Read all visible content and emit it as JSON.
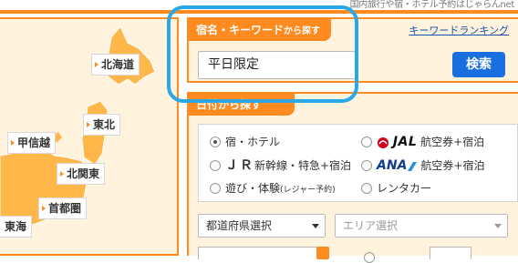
{
  "header": {
    "tagline": "国内旅行や宿・ホテル予約はじゃらんnet"
  },
  "map": {
    "regions": [
      {
        "id": "hokkaido",
        "label": "北海道"
      },
      {
        "id": "tohoku",
        "label": "東北"
      },
      {
        "id": "koshinetsu",
        "label": "甲信越"
      },
      {
        "id": "kitakanto",
        "label": "北関東"
      },
      {
        "id": "shutoken",
        "label": "首都圏"
      },
      {
        "id": "tokai",
        "label": "東海"
      }
    ],
    "colors": {
      "land": "#ffb74a",
      "background": "#fff3dd",
      "border": "#ff8a1f"
    }
  },
  "keyword_search": {
    "tab_label": "宿名・キーワード",
    "tab_label_small": "から探す",
    "ranking_link": "キーワードランキング",
    "input_value": "平日限定",
    "search_button": "検索"
  },
  "date_search": {
    "tab_label": "日付から探す"
  },
  "options": {
    "hotel": "宿・ホテル",
    "jal_brand": "JAL",
    "jal_suffix": "航空券+宿泊",
    "jr_brand": "ＪＲ",
    "jr_suffix": "新幹線・特急+宿泊",
    "ana_brand": "ANA",
    "ana_suffix": "航空券+宿泊",
    "leisure": "遊び・体験",
    "leisure_small": "(レジャー予約)",
    "rentacar": "レンタカー",
    "selected": "宿・ホテル"
  },
  "selects": {
    "prefecture": "都道府県選択",
    "area": "エリア選択"
  },
  "colors": {
    "accent": "#ff8a1f",
    "primary_button": "#1a6fe0",
    "highlight": "#29a8e8",
    "panel_bg": "#fff3dd",
    "link": "#1a4fa8"
  }
}
